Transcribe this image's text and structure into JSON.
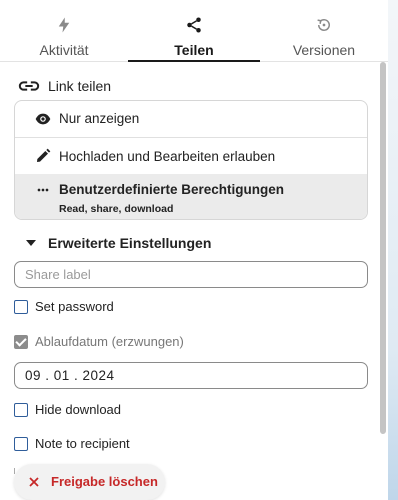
{
  "tabs": [
    {
      "label": "Aktivität",
      "icon": "lightning-icon",
      "active": false
    },
    {
      "label": "Teilen",
      "icon": "share-icon",
      "active": true
    },
    {
      "label": "Versionen",
      "icon": "history-icon",
      "active": false
    }
  ],
  "link_share": {
    "label": "Link teilen",
    "icon": "link-icon"
  },
  "permissions": [
    {
      "label": "Nur anzeigen",
      "icon": "eye-icon",
      "selected": false
    },
    {
      "label": "Hochladen und Bearbeiten erlauben",
      "icon": "pencil-icon",
      "selected": false
    },
    {
      "label": "Benutzerdefinierte Berechtigungen",
      "sublabel": "Read, share, download",
      "icon": "dots-icon",
      "selected": true
    }
  ],
  "advanced": {
    "label": "Erweiterte Einstellungen",
    "icon": "caret-down-icon",
    "expanded": true,
    "share_label_placeholder": "Share label",
    "share_label_value": "",
    "set_password": {
      "label": "Set password",
      "checked": false
    },
    "expiration": {
      "label": "Ablaufdatum (erzwungen)",
      "checked": true,
      "disabled": true
    },
    "expiration_date": "09 . 01 . 2024",
    "hide_download": {
      "label": "Hide download",
      "checked": false
    },
    "note_to_recipient": {
      "label": "Note to recipient",
      "checked": false
    }
  },
  "delete_button": {
    "label": "Freigabe löschen",
    "icon": "close-icon"
  },
  "colors": {
    "accent_text": "#1a1a1a",
    "checkbox_border": "#2f5d9a",
    "danger": "#c62828",
    "selected_bg": "#ebebeb"
  }
}
